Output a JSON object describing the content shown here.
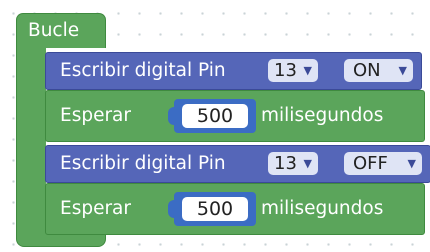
{
  "loop": {
    "label": "Bucle"
  },
  "blocks": [
    {
      "type": "digital-write",
      "label": "Escribir digital Pin",
      "pin": "13",
      "state": "ON"
    },
    {
      "type": "delay",
      "label": "Esperar",
      "value": "500",
      "unit": "milisegundos"
    },
    {
      "type": "digital-write",
      "label": "Escribir digital Pin",
      "pin": "13",
      "state": "OFF"
    },
    {
      "type": "delay",
      "label": "Esperar",
      "value": "500",
      "unit": "milisegundos"
    }
  ],
  "icons": {
    "dropdown": "dropdown-arrow-icon"
  },
  "colors": {
    "loop_block": "#5ba55b",
    "digital_write_block": "#5566b8",
    "number_slot": "#3b6cc4",
    "dropdown_bg": "#dfe4f5"
  }
}
